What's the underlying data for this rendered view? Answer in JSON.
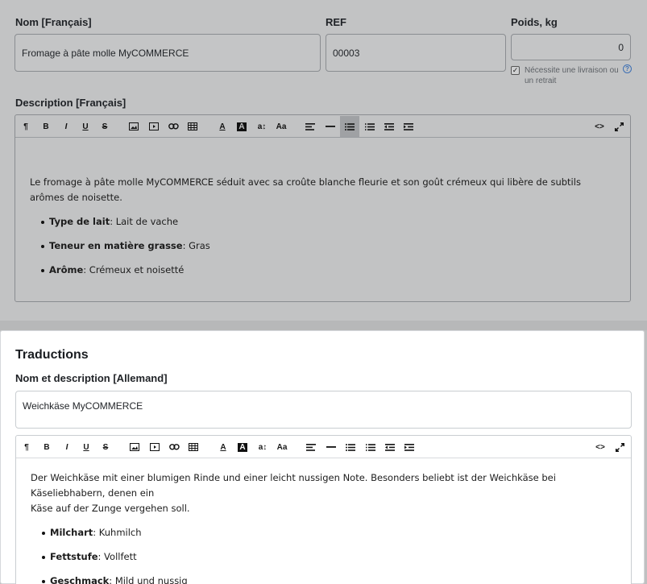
{
  "product": {
    "name_label": "Nom [Français]",
    "name_value": "Fromage à pâte molle MyCOMMERCE",
    "ref_label": "REF",
    "ref_value": "00003",
    "weight_label": "Poids, kg",
    "weight_value": "0",
    "shipping_checkbox_label_line1": "Nécessite une livraison ou",
    "shipping_checkbox_label_line2": "un retrait",
    "shipping_checked": true,
    "description_label": "Description [Français]",
    "description": {
      "intro": "Le fromage à pâte molle MyCOMMERCE séduit avec sa croûte blanche fleurie et son goût crémeux qui libère de subtils arômes de noisette.",
      "items": [
        {
          "key": "Type de lait",
          "value": ": Lait de vache"
        },
        {
          "key": "Teneur en matière grasse",
          "value": ": Gras"
        },
        {
          "key": "Arôme",
          "value": ": Crémeux et noisetté"
        }
      ]
    }
  },
  "translations": {
    "section_title": "Traductions",
    "subtitle": "Nom et description [Allemand]",
    "name_value": "Weichkäse MyCOMMERCE",
    "description": {
      "intro_line1": "Der Weichkäse mit einer blumigen Rinde und einer leicht nussigen Note. Besonders beliebt ist der Weichkäse bei Käseliebhabern, denen ein",
      "intro_line2": "Käse auf der Zunge vergehen soll.",
      "items": [
        {
          "key": "Milchart",
          "value": ": Kuhmilch"
        },
        {
          "key": "Fettstufe",
          "value": ": Vollfett"
        },
        {
          "key": "Geschmack",
          "value": ": Mild und nussig"
        }
      ]
    }
  },
  "toolbar": {
    "paragraph": "¶",
    "bold": "B",
    "italic": "I",
    "underline": "U",
    "strike": "S",
    "font_size": "a↕",
    "font_case": "Aa",
    "code": "<>"
  }
}
